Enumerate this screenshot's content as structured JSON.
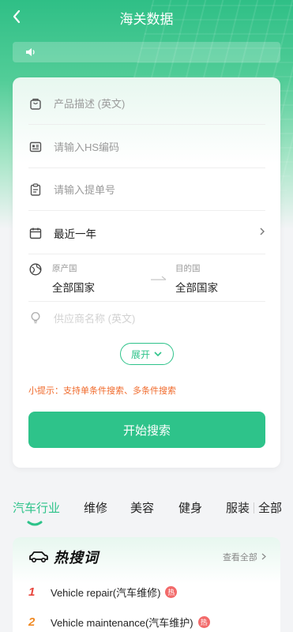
{
  "header": {
    "title": "海关数据"
  },
  "form": {
    "product_placeholder": "产品描述 (英文)",
    "hs_placeholder": "请输入HS编码",
    "bill_placeholder": "请输入提单号",
    "date_range": "最近一年",
    "origin": {
      "label": "原产国",
      "value": "全部国家"
    },
    "destination": {
      "label": "目的国",
      "value": "全部国家"
    },
    "supplier_placeholder": "供应商名称 (英文)",
    "expand_label": "展开",
    "tip": "小提示：支持单条件搜索、多条件搜索",
    "search_button": "开始搜索"
  },
  "tabs": [
    {
      "label": "汽车行业",
      "active": true
    },
    {
      "label": "维修"
    },
    {
      "label": "美容"
    },
    {
      "label": "健身"
    },
    {
      "label": "服装"
    },
    {
      "label": "全部"
    }
  ],
  "hot": {
    "title": "热搜词",
    "see_all": "查看全部",
    "badge": "热",
    "items": [
      {
        "rank": "1",
        "text": "Vehicle repair(汽车维修)",
        "rank_color": "#e8453c"
      },
      {
        "rank": "2",
        "text": "Vehicle maintenance(汽车维护)",
        "rank_color": "#f08a24"
      }
    ]
  },
  "colors": {
    "accent": "#2ec38a",
    "tip": "#f06a2b",
    "hot_badge": "#f26a6a"
  }
}
